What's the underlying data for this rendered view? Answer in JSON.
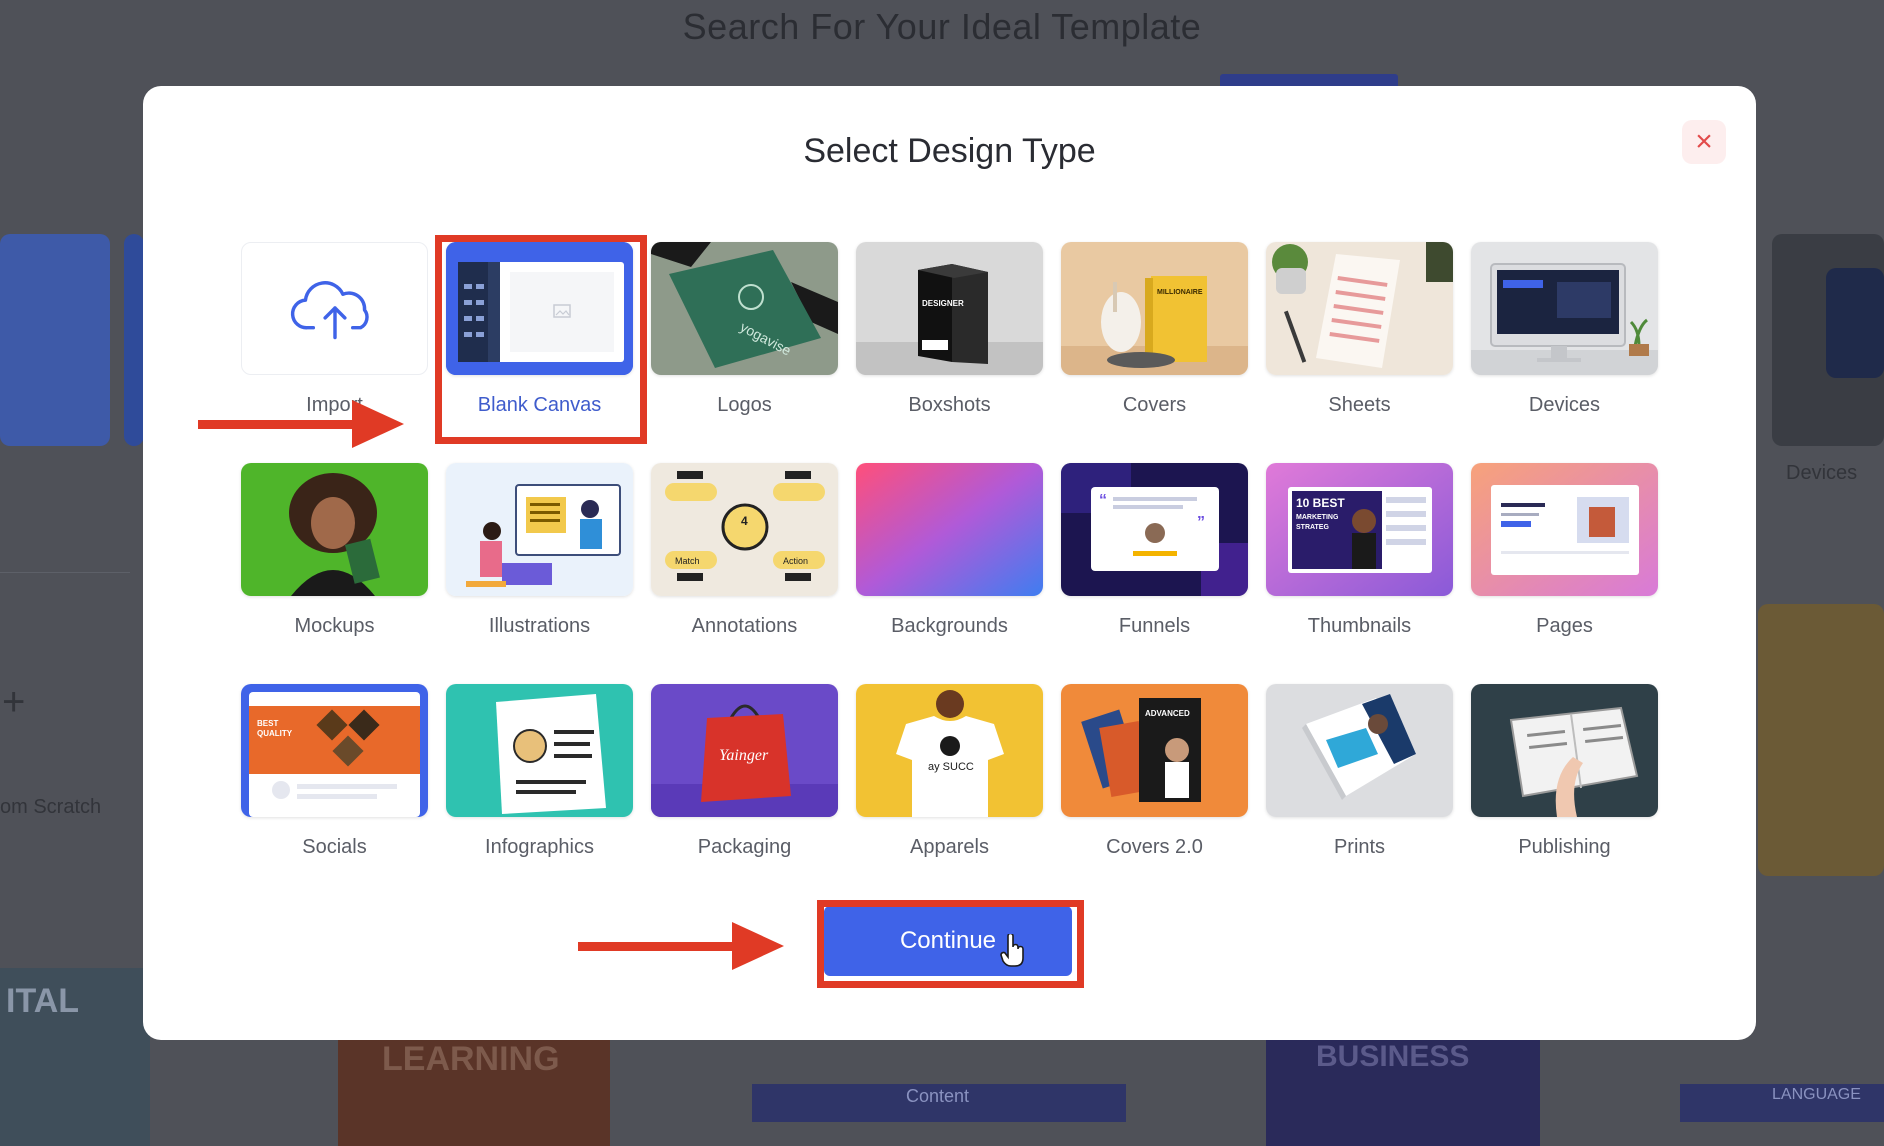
{
  "background": {
    "title": "Search For Your Ideal Template",
    "left_text": "om Scratch",
    "right_label": "Devices",
    "strip_texts": [
      "ITAL",
      "LEARNING",
      "Content",
      "BUSINESS",
      "LANGUAGE"
    ]
  },
  "modal": {
    "title": "Select Design Type",
    "close_label": "×",
    "continue_label": "Continue",
    "selected": "Blank Canvas",
    "items": [
      {
        "label": "Import",
        "thumb": "import"
      },
      {
        "label": "Blank Canvas",
        "thumb": "blank-canvas"
      },
      {
        "label": "Logos",
        "thumb": "logos"
      },
      {
        "label": "Boxshots",
        "thumb": "boxshots"
      },
      {
        "label": "Covers",
        "thumb": "covers"
      },
      {
        "label": "Sheets",
        "thumb": "sheets"
      },
      {
        "label": "Devices",
        "thumb": "devices"
      },
      {
        "label": "Mockups",
        "thumb": "mockups"
      },
      {
        "label": "Illustrations",
        "thumb": "illustrations"
      },
      {
        "label": "Annotations",
        "thumb": "annotations"
      },
      {
        "label": "Backgrounds",
        "thumb": "backgrounds"
      },
      {
        "label": "Funnels",
        "thumb": "funnels"
      },
      {
        "label": "Thumbnails",
        "thumb": "thumbnails"
      },
      {
        "label": "Pages",
        "thumb": "pages"
      },
      {
        "label": "Socials",
        "thumb": "socials"
      },
      {
        "label": "Infographics",
        "thumb": "infographics"
      },
      {
        "label": "Packaging",
        "thumb": "packaging"
      },
      {
        "label": "Apparels",
        "thumb": "apparels"
      },
      {
        "label": "Covers 2.0",
        "thumb": "covers-2"
      },
      {
        "label": "Prints",
        "thumb": "prints"
      },
      {
        "label": "Publishing",
        "thumb": "publishing"
      }
    ],
    "thumb_texts": {
      "logos": "yogavise",
      "boxshots": "DESIGNER",
      "covers": "MILLIONAIRE",
      "annotations": [
        "Match",
        "Action"
      ],
      "thumbnails": [
        "10 BEST",
        "MARKETING",
        "STRATEG"
      ],
      "socials": [
        "BEST",
        "QUALITY"
      ],
      "packaging": "Yainger",
      "apparels": "ay SUCC",
      "covers_2": "ADVANCED"
    }
  },
  "colors": {
    "accent": "#3f63e8",
    "annotation_red": "#e03a25",
    "close_red": "#e24b4b"
  }
}
